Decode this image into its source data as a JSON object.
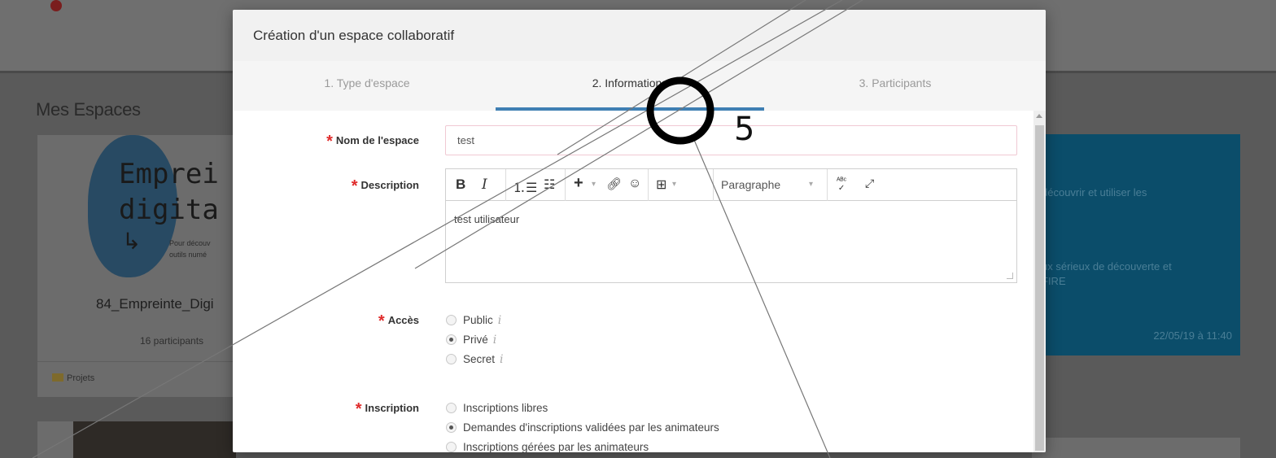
{
  "background": {
    "section_title": "Mes Espaces",
    "left_card": {
      "logo_text": "Emprei\ndigita",
      "logo_small": "Pour découv\noutils numé",
      "name": "84_Empreinte_Digi",
      "participants": "16 participants",
      "projects_link": "Projets"
    },
    "right_card": {
      "text1": "découvrir et utiliser les",
      "text2": "ux sérieux de découverte et\nFIRE",
      "date": "22/05/19 à 11:40"
    }
  },
  "modal": {
    "title": "Création d'un espace collaboratif",
    "tabs": [
      {
        "label": "1. Type d'espace",
        "active": false
      },
      {
        "label": "2. Informations",
        "active": true
      },
      {
        "label": "3. Participants",
        "active": false
      }
    ],
    "fields": {
      "name": {
        "label": "Nom de l'espace",
        "value": "test"
      },
      "description": {
        "label": "Description",
        "value": "test utilisateur",
        "format_select": "Paragraphe"
      },
      "access": {
        "label": "Accès",
        "options": [
          {
            "label": "Public",
            "checked": false
          },
          {
            "label": "Privé",
            "checked": true
          },
          {
            "label": "Secret",
            "checked": false
          }
        ]
      },
      "inscription": {
        "label": "Inscription",
        "options": [
          {
            "label": "Inscriptions libres",
            "checked": false
          },
          {
            "label": "Demandes d'inscriptions validées par les animateurs",
            "checked": true
          },
          {
            "label": "Inscriptions gérées par les animateurs",
            "checked": false
          }
        ]
      }
    },
    "required_marker": "*",
    "info_marker": "i"
  },
  "annotation": {
    "number": "5"
  },
  "colors": {
    "accent": "#3f7fb3",
    "required": "#e02b2b",
    "dimmed_bg": "#5a5a5a"
  }
}
